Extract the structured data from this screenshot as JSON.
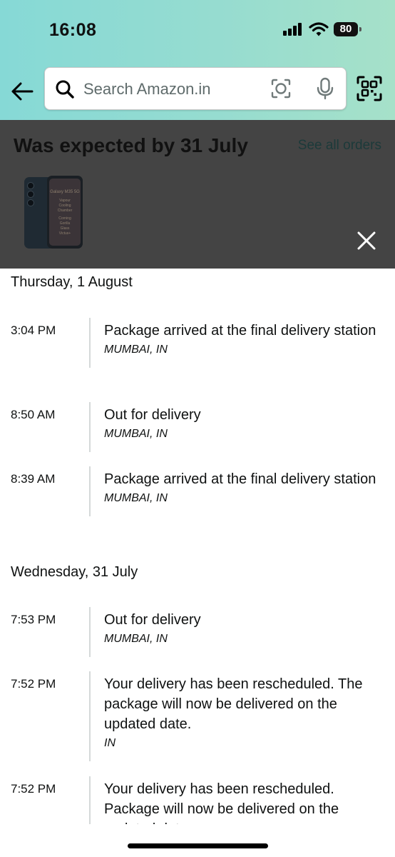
{
  "status_bar": {
    "time": "16:08",
    "battery": "80"
  },
  "search": {
    "placeholder": "Search Amazon.in"
  },
  "panel": {
    "title": "Was expected by 31 July",
    "see_all_orders": "See all orders",
    "product_screen_text": [
      "Galaxy M35 5G",
      "Vapour",
      "Cooling",
      "Chamber",
      "Corning",
      "Gorilla",
      "Glass",
      "Victus+"
    ]
  },
  "timeline": {
    "days": [
      {
        "date": "Thursday, 1 August",
        "events": [
          {
            "time": "3:04 PM",
            "description": "Package arrived at the final delivery station",
            "location": "MUMBAI, IN"
          },
          {
            "time": "8:50 AM",
            "description": "Out for delivery",
            "location": "MUMBAI, IN"
          },
          {
            "time": "8:39 AM",
            "description": "Package arrived at the final delivery station",
            "location": "MUMBAI, IN"
          }
        ]
      },
      {
        "date": "Wednesday, 31 July",
        "events": [
          {
            "time": "7:53 PM",
            "description": "Out for delivery",
            "location": "MUMBAI, IN"
          },
          {
            "time": "7:52 PM",
            "description": "Your delivery has been rescheduled. The package will now be delivered on the updated date.",
            "location": "IN"
          },
          {
            "time": "7:52 PM",
            "description": "Your delivery has been rescheduled. Package will now be delivered on the updated date.",
            "location": ""
          }
        ]
      }
    ]
  },
  "colors": {
    "header_teal": "#96dcd0",
    "panel_overlay": "#444444",
    "divider": "#d5d9d9"
  }
}
